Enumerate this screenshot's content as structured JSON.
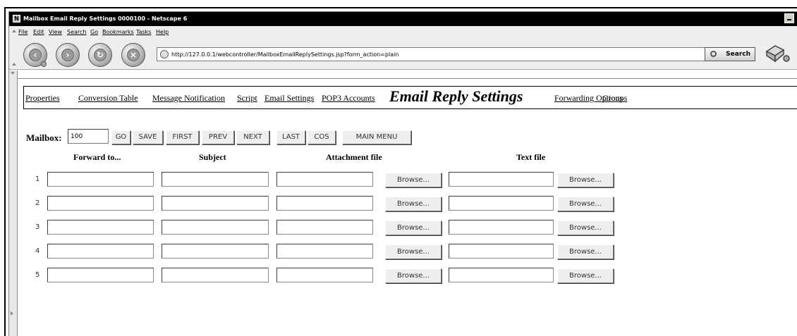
{
  "window": {
    "title": "Mailbox Email Reply Settings 0000100 - Netscape 6",
    "app_icon": "N"
  },
  "menubar": {
    "items": [
      "File",
      "Edit",
      "View",
      "Search",
      "Go",
      "Bookmarks",
      "Tasks",
      "Help"
    ]
  },
  "navbar": {
    "back_icon": "back-arrow-icon",
    "forward_icon": "forward-arrow-icon",
    "reload_icon": "reload-icon",
    "stop_icon": "stop-icon",
    "url": "http://127.0.0.1/webcontroller/MailboxEmailReplySettings.jsp?form_action=plain",
    "search_label": "Search"
  },
  "tabs": {
    "properties": "Properties",
    "conversion_table": "Conversion Table",
    "message_notification": "Message Notification",
    "script": "Script",
    "email_settings": "Email Settings",
    "pop3_accounts": "POP3 Accounts",
    "active": "Email Reply Settings",
    "forwarding_options": "Forwarding Options",
    "groups": "Groups"
  },
  "controls": {
    "mailbox_label": "Mailbox:",
    "mailbox_value": "100",
    "go": "GO",
    "save": "SAVE",
    "first": "FIRST",
    "prev": "PREV",
    "next": "NEXT",
    "last": "LAST",
    "cos": "COS",
    "main_menu": "MAIN MENU"
  },
  "table": {
    "headers": {
      "forward_to": "Forward to...",
      "subject": "Subject",
      "attachment_file": "Attachment file",
      "text_file": "Text file"
    },
    "browse_label": "Browse...",
    "rows": [
      {
        "num": "1",
        "forward_to": "",
        "subject": "",
        "attachment": "",
        "text_file": ""
      },
      {
        "num": "2",
        "forward_to": "",
        "subject": "",
        "attachment": "",
        "text_file": ""
      },
      {
        "num": "3",
        "forward_to": "",
        "subject": "",
        "attachment": "",
        "text_file": ""
      },
      {
        "num": "4",
        "forward_to": "",
        "subject": "",
        "attachment": "",
        "text_file": ""
      },
      {
        "num": "5",
        "forward_to": "",
        "subject": "",
        "attachment": "",
        "text_file": ""
      }
    ]
  }
}
